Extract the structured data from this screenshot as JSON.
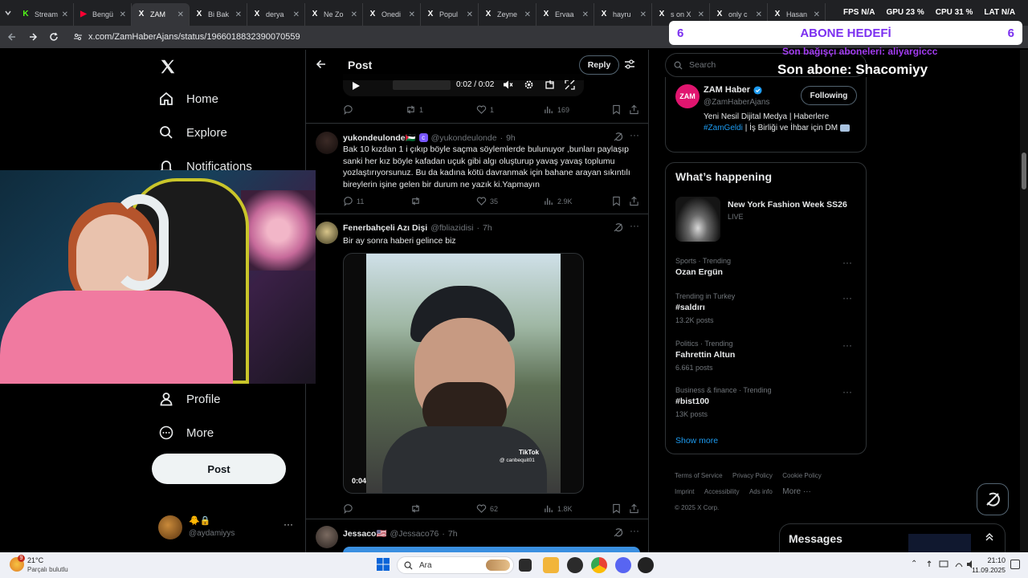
{
  "browser": {
    "tabs": [
      {
        "label": "Stream",
        "icon": "kick-icon",
        "color": "#53fc18"
      },
      {
        "label": "Bengü",
        "icon": "youtube-icon",
        "color": "#ff0033"
      },
      {
        "label": "ZAM",
        "icon": "x-icon",
        "color": "#ffffff",
        "active": true
      },
      {
        "label": "Bi Bak",
        "icon": "x-icon",
        "color": "#ffffff"
      },
      {
        "label": "derya",
        "icon": "x-icon",
        "color": "#ffffff"
      },
      {
        "label": "Ne Zo",
        "icon": "x-icon",
        "color": "#ffffff"
      },
      {
        "label": "Onedi",
        "icon": "x-icon",
        "color": "#ffffff"
      },
      {
        "label": "Popul",
        "icon": "x-icon",
        "color": "#ffffff"
      },
      {
        "label": "Zeyne",
        "icon": "x-icon",
        "color": "#ffffff"
      },
      {
        "label": "Ervaa",
        "icon": "x-icon",
        "color": "#ffffff"
      },
      {
        "label": "hayru",
        "icon": "x-icon",
        "color": "#ffffff"
      },
      {
        "label": "s on X",
        "icon": "x-icon",
        "color": "#ffffff"
      },
      {
        "label": "only c",
        "icon": "x-icon",
        "color": "#ffffff"
      },
      {
        "label": "Hasan",
        "icon": "x-icon",
        "color": "#ffffff"
      }
    ],
    "url": "x.com/ZamHaberAjans/status/1966018832390070559"
  },
  "overlay": {
    "goal_left": "6",
    "goal_title": "ABONE HEDEFİ",
    "goal_right": "6",
    "donor_line": "Son bağışçı aboneleri: aliyargiccc",
    "last_sub": "Son abone: Shacomiyy",
    "stats": [
      {
        "label": "FPS",
        "value": "N/A"
      },
      {
        "label": "GPU",
        "value": "23 %"
      },
      {
        "label": "CPU",
        "value": "31 %"
      },
      {
        "label": "LAT",
        "value": "N/A"
      }
    ]
  },
  "nav": {
    "items": [
      {
        "label": "Home",
        "icon": "home-icon"
      },
      {
        "label": "Explore",
        "icon": "search-icon"
      },
      {
        "label": "Notifications",
        "icon": "bell-icon"
      },
      {
        "label": "Profile",
        "icon": "person-icon"
      },
      {
        "label": "More",
        "icon": "more-circle-icon"
      }
    ],
    "post_button": "Post",
    "account_handle": "@aydamiyys"
  },
  "header": {
    "title": "Post",
    "reply_button": "Reply"
  },
  "video_top": {
    "time": "0:02 / 0:02"
  },
  "tweets": [
    {
      "kind": "first-actions",
      "replies": "",
      "reposts": "1",
      "likes": "1",
      "views": "169"
    },
    {
      "name": "yukondeulonde🇵🇸",
      "handle": "@yukondeulonde",
      "time": "9h",
      "text": "Bak 10 kızdan 1 i çıkıp böyle saçma söylemlerde bulunuyor ,bunları paylaşıp sanki her kız böyle kafadan uçuk gibi algı oluşturup yavaş yavaş toplumu yozlaştırıyorsunuz. Bu da kadına kötü davranmak için bahane arayan sıkıntılı bireylerin işine gelen bir durum ne yazık ki.Yapmayın",
      "replies": "11",
      "reposts": "",
      "likes": "35",
      "views": "2.9K"
    },
    {
      "name": "Fenerbahçeli Azı Dişi",
      "handle": "@fbliazidisi",
      "time": "7h",
      "text": "Bir ay sonra haberi gelince biz",
      "video_duration": "0:04",
      "watermark_brand": "TikTok",
      "watermark_user": "@ canbequit01",
      "replies": "",
      "reposts": "",
      "likes": "62",
      "views": "1.8K"
    },
    {
      "name": "Jessaco🇺🇸",
      "handle": "@Jessaco76",
      "time": "7h"
    }
  ],
  "search": {
    "placeholder": "Search"
  },
  "profile_card": {
    "name": "ZAM Haber",
    "handle": "@ZamHaberAjans",
    "follow_button": "Following",
    "bio": "Yeni Nesil Dijital Medya | Haberlere",
    "bio_hashtag": "#ZamGeldi",
    "bio_rest": "| İş Birliği ve İhbar için DM",
    "avatar_text": "ZAM"
  },
  "happening": {
    "title": "What’s happening",
    "event": {
      "title": "New York Fashion Week SS26",
      "status": "LIVE"
    },
    "trends": [
      {
        "meta": "Sports · Trending",
        "title": "Ozan Ergün",
        "count": ""
      },
      {
        "meta": "Trending in Turkey",
        "title": "#saldırı",
        "count": "13.2K posts"
      },
      {
        "meta": "Politics · Trending",
        "title": "Fahrettin Altun",
        "count": "6.661 posts"
      },
      {
        "meta": "Business & finance · Trending",
        "title": "#bist100",
        "count": "13K posts"
      }
    ],
    "show_more": "Show more"
  },
  "footer": {
    "links": [
      "Terms of Service",
      "Privacy Policy",
      "Cookie Policy",
      "Imprint",
      "Accessibility",
      "Ads info",
      "More ···"
    ],
    "copyright": "© 2025 X Corp."
  },
  "messages": {
    "title": "Messages"
  },
  "taskbar": {
    "weather_temp": "21°C",
    "weather_desc": "Parçalı bulutlu",
    "search_label": "Ara",
    "time": "21:10",
    "date": "11.09.2025",
    "notif_badge": "9"
  },
  "colors": {
    "accent": "#1d9bf0",
    "goal_purple": "#7b2ff0",
    "zam_pink": "#e0156f"
  }
}
